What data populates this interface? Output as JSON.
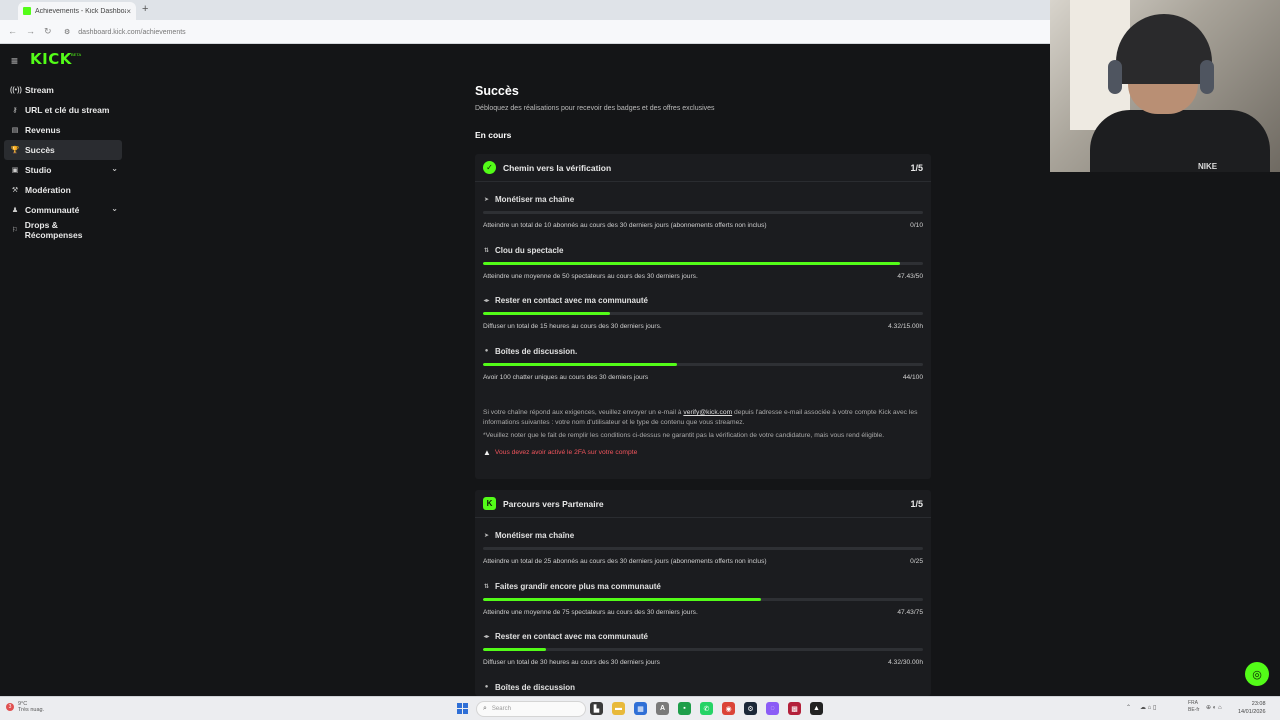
{
  "browser": {
    "tab_title": "Achievements - Kick Dashboard",
    "tab_close": "×",
    "new_tab": "+",
    "back": "←",
    "forward": "→",
    "reload": "↻",
    "site_icon": "⚙",
    "url": "dashboard.kick.com/achievements"
  },
  "header": {
    "menu_icon": "≡",
    "logo": "KICK",
    "logo_tag": "BETA"
  },
  "sidebar": {
    "items": [
      {
        "label": "Stream",
        "icon": "((•))",
        "active": false
      },
      {
        "label": "URL et clé du stream",
        "icon": "⚷",
        "active": false
      },
      {
        "label": "Revenus",
        "icon": "▤",
        "active": false
      },
      {
        "label": "Succès",
        "icon": "🏆",
        "active": true
      },
      {
        "label": "Studio",
        "icon": "▣",
        "active": false,
        "expandable": true
      },
      {
        "label": "Modération",
        "icon": "⚒",
        "active": false
      },
      {
        "label": "Communauté",
        "icon": "♟",
        "active": false,
        "expandable": true
      },
      {
        "label": "Drops & Récompenses",
        "icon": "⚐",
        "active": false
      }
    ],
    "chevron": "⌄"
  },
  "main": {
    "title": "Succès",
    "subtitle": "Débloquez des réalisations pour recevoir des badges et des offres exclusives",
    "section": "En cours"
  },
  "cards": [
    {
      "title": "Chemin vers la vérification",
      "count": "1/5",
      "badge": "✓",
      "tasks": [
        {
          "icon": "➤",
          "title": "Monétiser ma chaîne",
          "desc": "Atteindre un total de 10 abonnés au cours des 30 derniers jours (abonnements offerts non inclus)",
          "value": "0/10",
          "progress": 0
        },
        {
          "icon": "⇅",
          "title": "Clou du spectacle",
          "desc": "Atteindre une moyenne de 50 spectateurs au cours des 30 derniers jours.",
          "value": "47.43/50",
          "progress": 0.9486
        },
        {
          "icon": "◂▸",
          "title": "Rester en contact avec ma communauté",
          "desc": "Diffuser un total de 15 heures au cours des 30 derniers jours.",
          "value": "4.32/15.00h",
          "progress": 0.288
        },
        {
          "icon": "●",
          "title": "Boîtes de discussion.",
          "desc": "Avoir 100 chatter uniques au cours des 30 derniers jours",
          "value": "44/100",
          "progress": 0.44
        }
      ],
      "note1_pre": "Si votre chaîne répond aux exigences, veuillez envoyer un e-mail à ",
      "note1_link": "verify@kick.com",
      "note1_post": " depuis l'adresse e-mail associée à votre compte Kick avec les informations suivantes : votre nom d'utilisateur et le type de contenu que vous streamez.",
      "note2": "*Veuillez noter que le fait de remplir les conditions ci-dessus ne garantit pas la vérification de votre candidature, mais vous rend éligible.",
      "warning": "Vous devez avoir activé le 2FA sur votre compte",
      "warning_icon": "▲"
    },
    {
      "title": "Parcours vers Partenaire",
      "count": "1/5",
      "badge": "K",
      "tasks": [
        {
          "icon": "➤",
          "title": "Monétiser ma chaîne",
          "desc": "Atteindre un total de 25 abonnés au cours des 30 derniers jours (abonnements offerts non inclus)",
          "value": "0/25",
          "progress": 0
        },
        {
          "icon": "⇅",
          "title": "Faites grandir encore plus ma communauté",
          "desc": "Atteindre une moyenne de 75 spectateurs au cours des 30 derniers jours.",
          "value": "47.43/75",
          "progress": 0.6324
        },
        {
          "icon": "◂▸",
          "title": "Rester en contact avec ma communauté",
          "desc": "Diffuser un total de 30 heures au cours des 30 derniers jours",
          "value": "4.32/30.00h",
          "progress": 0.144
        },
        {
          "icon": "●",
          "title": "Boîtes de discussion",
          "desc": "",
          "value": "",
          "progress": null
        }
      ]
    }
  ],
  "fab_icon": "◎",
  "webcam": {
    "shirt_text": "NIKE"
  },
  "taskbar": {
    "weather_badge": "3",
    "weather_temp": "9°C",
    "weather_desc": "Très nuag.",
    "search_icon": "⌕",
    "search_placeholder": "Search",
    "apps": [
      {
        "name": "files",
        "color": "#3a3a3a",
        "glyph": "▙"
      },
      {
        "name": "explorer",
        "color": "#e8b93a",
        "glyph": "▬"
      },
      {
        "name": "store",
        "color": "#2f6fd6",
        "glyph": "▦"
      },
      {
        "name": "app-a",
        "color": "#7a7a7a",
        "glyph": "A"
      },
      {
        "name": "app-kick",
        "color": "#1e9e4a",
        "glyph": "▪"
      },
      {
        "name": "whatsapp",
        "color": "#25d366",
        "glyph": "✆"
      },
      {
        "name": "chrome",
        "color": "#db4437",
        "glyph": "◉"
      },
      {
        "name": "steam",
        "color": "#1b2838",
        "glyph": "⚙"
      },
      {
        "name": "app-b",
        "color": "#8b5cf6",
        "glyph": "◌"
      },
      {
        "name": "app-c",
        "color": "#b3203a",
        "glyph": "▩"
      },
      {
        "name": "app-d",
        "color": "#222222",
        "glyph": "▲"
      }
    ],
    "tray_chevron": "⌃",
    "tray_icons": "☁ ⌂ ▯",
    "lang": "FRA",
    "lang2": "BE-fr",
    "tray_icons2": "⊕ ◐ ⌂",
    "time": "23:08",
    "date": "14/01/2026"
  },
  "colors": {
    "accent": "#53fc18",
    "background": "#141517",
    "card": "#1b1c1f",
    "warning": "#f0545c"
  }
}
